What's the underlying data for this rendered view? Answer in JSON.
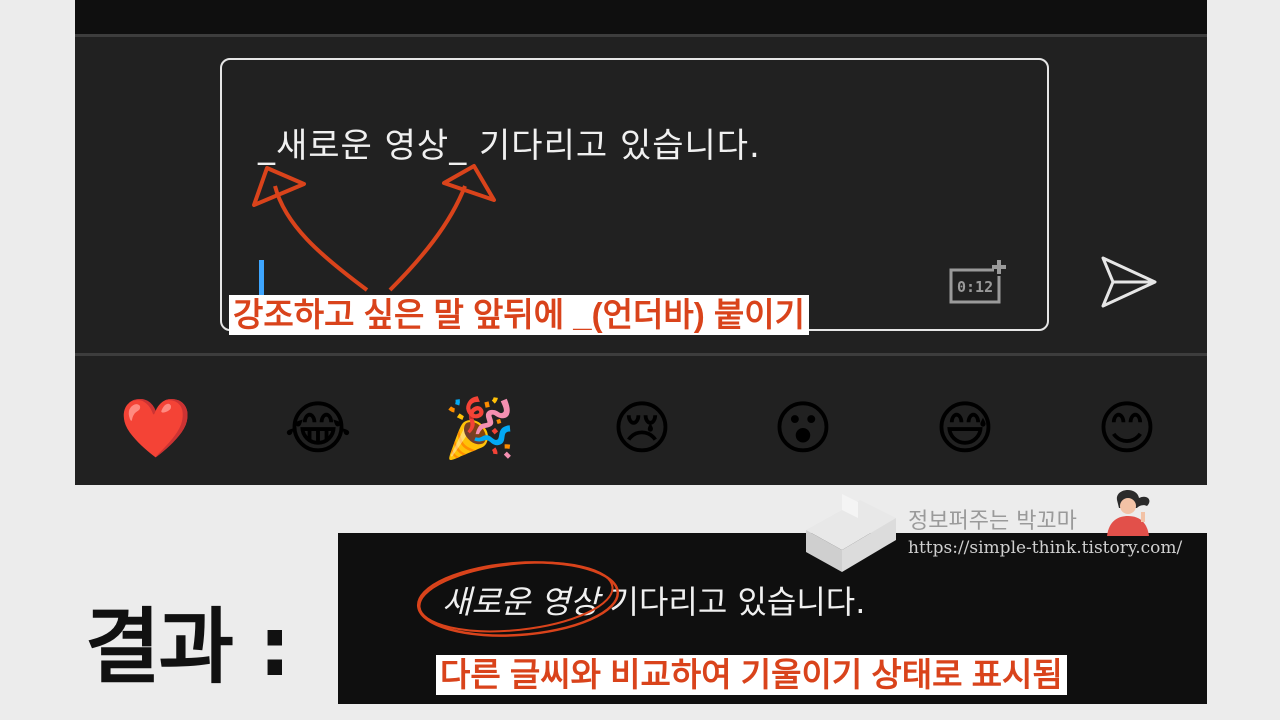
{
  "compose": {
    "text": "_새로운 영상_ 기다리고 있습니다.",
    "timestamp_label": "0:12"
  },
  "annotation_top": "강조하고 싶은 말 앞뒤에 _(언더바) 붙이기",
  "reactions": [
    "❤️",
    "😂",
    "🎉",
    "😢",
    "😮",
    "😅",
    "😊"
  ],
  "result": {
    "label": "결과 :",
    "text_italic": "새로운 영상",
    "text_rest": " 기다리고 있습니다.",
    "annotation": "다른 글씨와 비교하여 기울이기 상태로 표시됨"
  },
  "watermark": {
    "name": "정보퍼주는 박꼬마",
    "url": "https://simple-think.tistory.com/"
  },
  "colors": {
    "accent_red": "#d9431b",
    "caret_blue": "#3ea6ff",
    "panel_dark": "#212121"
  }
}
